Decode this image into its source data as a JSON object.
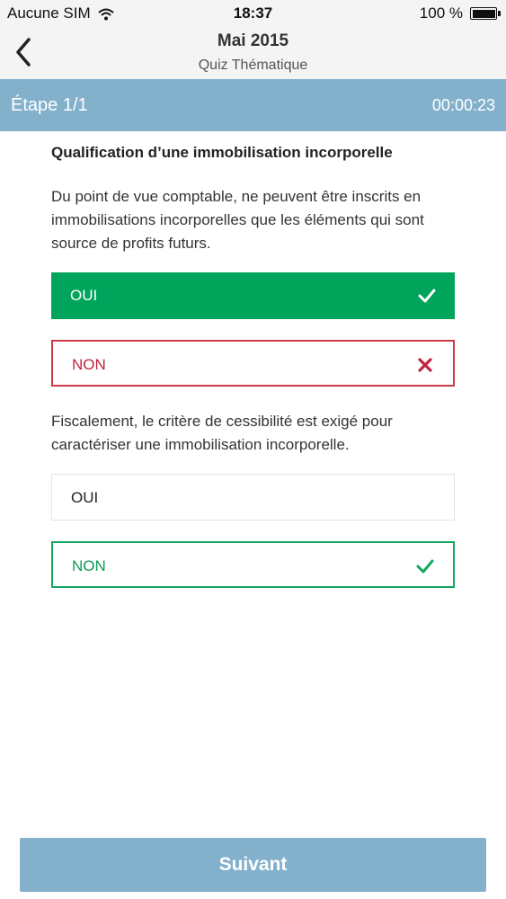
{
  "status": {
    "carrier": "Aucune SIM",
    "time": "18:37",
    "battery": "100 %"
  },
  "nav": {
    "title": "Mai 2015",
    "subtitle": "Quiz Thématique"
  },
  "step": {
    "label": "Étape 1/1",
    "timer": "00:00:23"
  },
  "quiz": {
    "title": "Qualification d’une immobilisation incorporelle",
    "questions": [
      {
        "text": "Du point de vue comptable, ne peuvent être inscrits en immobilisations incorporelles que les éléments qui sont source de profits futurs.",
        "options": [
          {
            "label": "OUI",
            "state": "correct-selected",
            "icon": "check-icon"
          },
          {
            "label": "NON",
            "state": "wrong",
            "icon": "cross-icon"
          }
        ]
      },
      {
        "text": "Fiscalement, le critère de cessibilité est exigé pour caractériser une immobilisation incorporelle.",
        "options": [
          {
            "label": "OUI",
            "state": "neutral",
            "icon": ""
          },
          {
            "label": "NON",
            "state": "correct",
            "icon": "check-icon"
          }
        ]
      }
    ]
  },
  "footer": {
    "next_label": "Suivant"
  },
  "colors": {
    "accent": "#83b1cc",
    "correct": "#00a45a",
    "wrong": "#cc3a4a"
  }
}
